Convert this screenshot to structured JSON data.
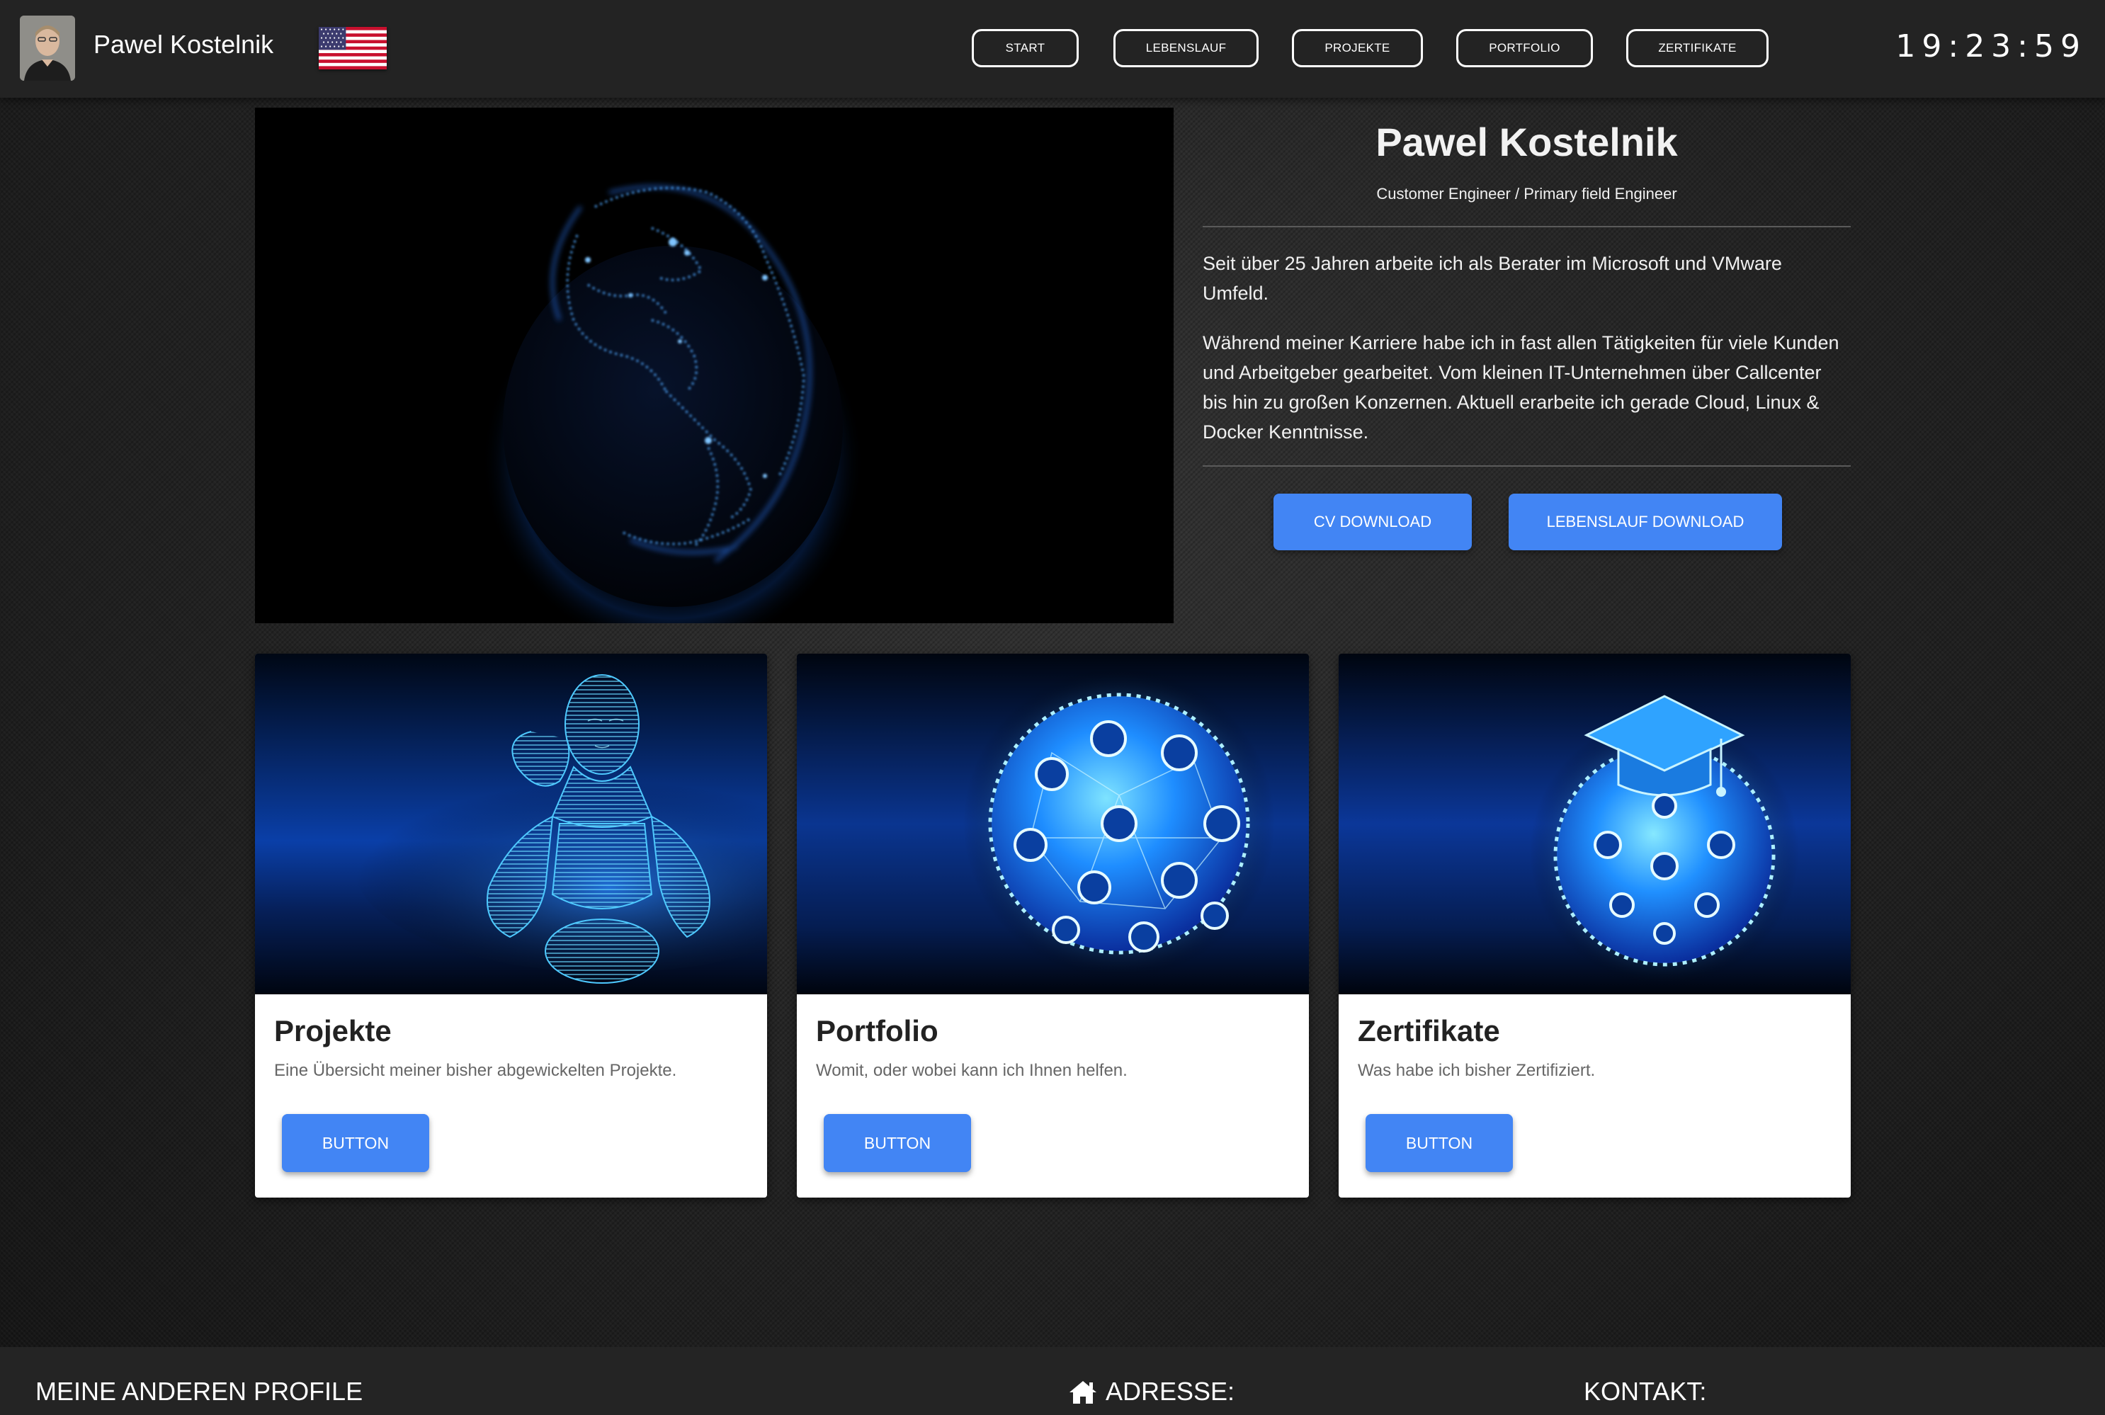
{
  "header": {
    "user_name": "Pawel Kostelnik",
    "avatar": "profile-photo",
    "language_flag": "us-flag-icon",
    "nav": [
      {
        "label": "START"
      },
      {
        "label": "LEBENSLAUF"
      },
      {
        "label": "PROJEKTE"
      },
      {
        "label": "PORTFOLIO"
      },
      {
        "label": "ZERTIFIKATE"
      }
    ],
    "clock": "19:23:59"
  },
  "hero": {
    "media": "globe-network-animation",
    "name": "Pawel Kostelnik",
    "role": "Customer Engineer / Primary field Engineer",
    "paragraphs": [
      "Seit über 25 Jahren arbeite ich als Berater im Microsoft und VMware Umfeld.",
      "Während meiner Karriere habe ich in fast allen Tätigkeiten für viele Kunden und Arbeitgeber gearbeitet. Vom kleinen IT-Unternehmen über Callcenter bis hin zu großen Konzernen. Aktuell erarbeite ich gerade Cloud, Linux & Docker Kenntnisse."
    ],
    "buttons": {
      "cv": "CV DOWNLOAD",
      "lebenslauf": "LEBENSLAUF DOWNLOAD"
    }
  },
  "cards": [
    {
      "image": "cyber-robot-illustration",
      "title": "Projekte",
      "text": "Eine Übersicht meiner bisher abgewickelten Projekte.",
      "button": "BUTTON"
    },
    {
      "image": "digital-globe-books-illustration",
      "title": "Portfolio",
      "text": "Womit, oder wobei kann ich Ihnen helfen.",
      "button": "BUTTON"
    },
    {
      "image": "graduation-globe-illustration",
      "title": "Zertifikate",
      "text": "Was habe ich bisher Zertifiziert.",
      "button": "BUTTON"
    }
  ],
  "footer": {
    "profiles_heading": "MEINE ANDEREN PROFILE",
    "address_heading": "ADRESSE:",
    "address_icon": "home-icon",
    "contact_heading": "KONTAKT:"
  },
  "colors": {
    "accent": "#4285f4",
    "header_bg": "#232323",
    "glow": "#2f8cff"
  }
}
